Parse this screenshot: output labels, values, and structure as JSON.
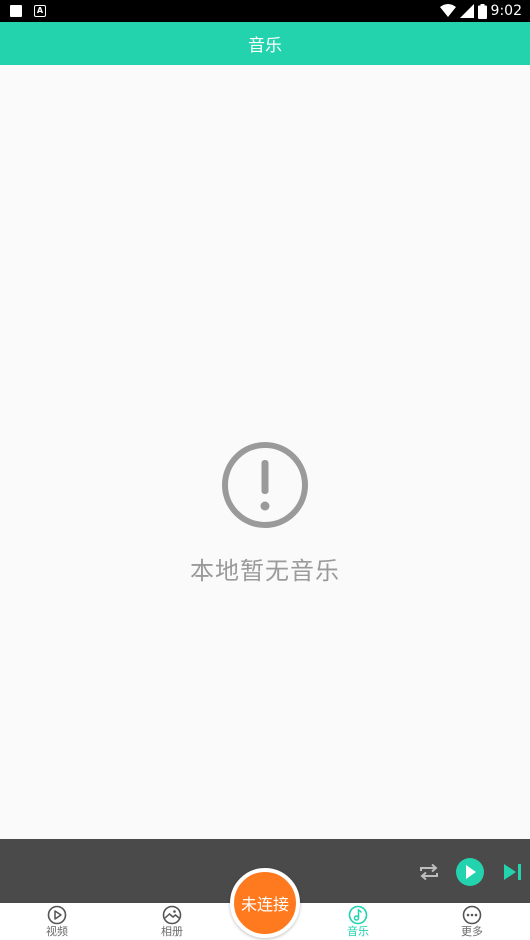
{
  "status_bar": {
    "time": "9:02"
  },
  "app_bar": {
    "title": "音乐"
  },
  "empty_state": {
    "message": "本地暂无音乐",
    "icon": "alert-circle-icon"
  },
  "player": {
    "controls": [
      "repeat-icon",
      "play-icon",
      "skip-next-icon"
    ]
  },
  "bottom_nav": {
    "items": [
      {
        "label": "视频",
        "icon": "play-circle-icon",
        "active": false
      },
      {
        "label": "相册",
        "icon": "image-icon",
        "active": false
      },
      {
        "label": "音乐",
        "icon": "music-note-icon",
        "active": true
      },
      {
        "label": "更多",
        "icon": "more-horizontal-icon",
        "active": false
      }
    ],
    "center_button": "未连接"
  },
  "colors": {
    "accent": "#22d3ae",
    "connect": "#ff7a1f",
    "player_bg": "#4a4a4a",
    "empty_text": "#9a9a9a"
  }
}
